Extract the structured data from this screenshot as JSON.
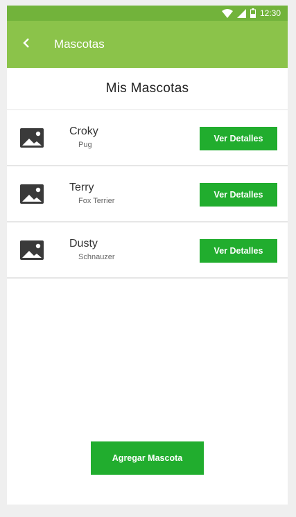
{
  "status_bar": {
    "time": "12:30",
    "icons": [
      "wifi-icon",
      "signal-icon",
      "battery-icon"
    ]
  },
  "app_bar": {
    "title": "Mascotas",
    "back_icon": "chevron-left-icon",
    "color": "#8bc34a"
  },
  "main": {
    "section_title": "Mis Mascotas",
    "pets": [
      {
        "name": "Croky",
        "breed": "Pug",
        "button_label": "Ver Detalles",
        "photo_icon": "image-icon"
      },
      {
        "name": "Terry",
        "breed": "Fox Terrier",
        "button_label": "Ver Detalles",
        "photo_icon": "image-icon"
      },
      {
        "name": "Dusty",
        "breed": "Schnauzer",
        "button_label": "Ver Detalles",
        "photo_icon": "image-icon"
      }
    ],
    "add_button_label": "Agregar Mascota",
    "button_color": "#21ad2e"
  }
}
